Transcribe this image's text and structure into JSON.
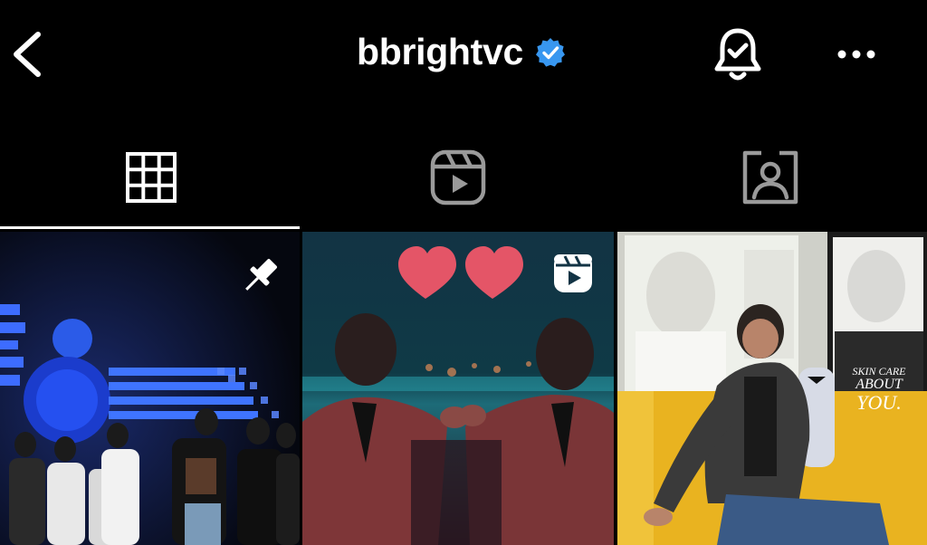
{
  "header": {
    "username": "bbrightvc",
    "icons": {
      "back": "chevron-left-icon",
      "verified": "verified-badge-icon",
      "notifications": "bell-check-icon",
      "more": "more-horizontal-icon"
    }
  },
  "tabs": [
    {
      "name": "posts-grid",
      "icon": "grid-icon",
      "active": true
    },
    {
      "name": "reels",
      "icon": "reels-icon",
      "active": false
    },
    {
      "name": "tagged",
      "icon": "tagged-person-icon",
      "active": false
    }
  ],
  "posts": [
    {
      "kind": "pinned-photo",
      "badge_icon": "pin-icon"
    },
    {
      "kind": "reel",
      "badge_icon": "reels-icon",
      "sticker": "two-hearts"
    },
    {
      "kind": "photo",
      "sign_text": [
        "SKIN CARE",
        "ABOUT",
        "YOU."
      ]
    }
  ],
  "colors": {
    "background": "#000000",
    "verified_blue": "#3897f0",
    "heart_red": "#e45567",
    "active_indicator": "#ffffff"
  }
}
